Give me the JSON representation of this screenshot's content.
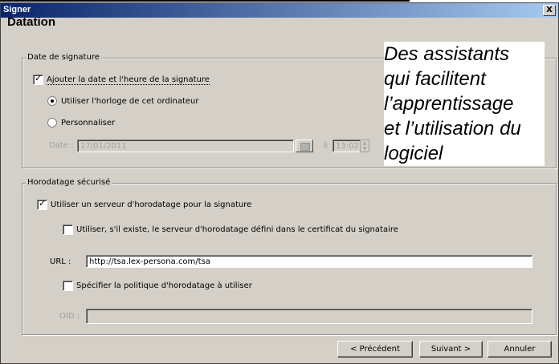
{
  "window": {
    "title": "Signer",
    "close_symbol": "X"
  },
  "page_title": "Datation",
  "date_group": {
    "legend": "Date de signature",
    "add_date_label": "Ajouter la date et l'heure de la signature",
    "add_date_checked": true,
    "radio_computer_clock": "Utiliser l'horloge de cet ordinateur",
    "radio_custom": "Personnaliser",
    "selected_radio": "computer_clock",
    "date_label": "Date :",
    "date_value": "17/01/2011",
    "at_label": "à",
    "time_value": "13:02"
  },
  "timestamp_group": {
    "legend": "Horodatage sécurisé",
    "use_server_label": "Utiliser un serveur d'horodatage pour la signature",
    "use_server_checked": true,
    "use_cert_server_label": "Utiliser, s'il existe, le serveur d'horodatage défini dans le certificat du signataire",
    "use_cert_server_checked": false,
    "url_label": "URL :",
    "url_value": "http://tsa.lex-persona.com/tsa",
    "policy_label": "Spécifier la politique d'horodatage à utiliser",
    "policy_checked": false,
    "oid_label": "OID :",
    "oid_value": ""
  },
  "buttons": {
    "previous": "< Précédent",
    "next": "Suivant >",
    "cancel": "Annuler"
  },
  "overlay_text": [
    "Des assistants",
    "qui facilitent",
    "l’apprentissage",
    "et l’utilisation du",
    "logiciel"
  ]
}
